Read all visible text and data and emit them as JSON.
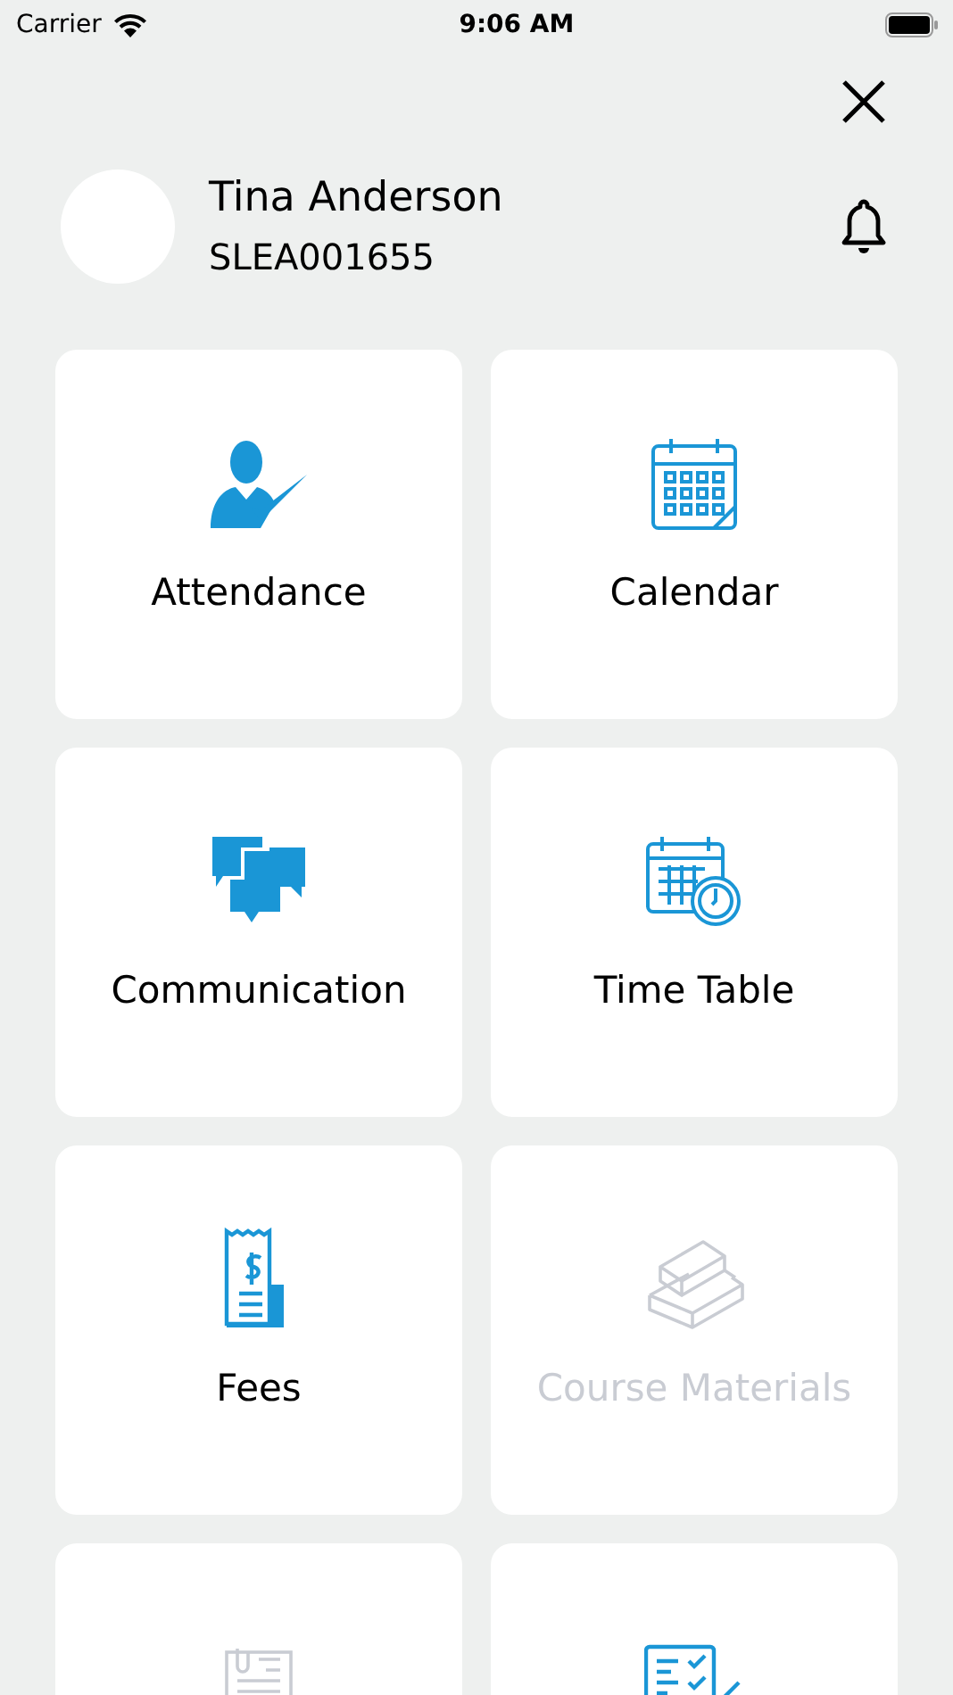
{
  "status_bar": {
    "carrier": "Carrier",
    "time": "9:06 AM"
  },
  "profile": {
    "name": "Tina Anderson",
    "id": "SLEA001655"
  },
  "tiles": [
    {
      "kind": "attendance",
      "label": "Attendance",
      "disabled": false
    },
    {
      "kind": "calendar",
      "label": "Calendar",
      "disabled": false
    },
    {
      "kind": "communication",
      "label": "Communication",
      "disabled": false
    },
    {
      "kind": "timetable",
      "label": "Time Table",
      "disabled": false
    },
    {
      "kind": "fees",
      "label": "Fees",
      "disabled": false
    },
    {
      "kind": "books",
      "label": "Course Materials",
      "disabled": true
    },
    {
      "kind": "document",
      "disabled": true
    },
    {
      "kind": "checklist",
      "disabled": false
    }
  ]
}
